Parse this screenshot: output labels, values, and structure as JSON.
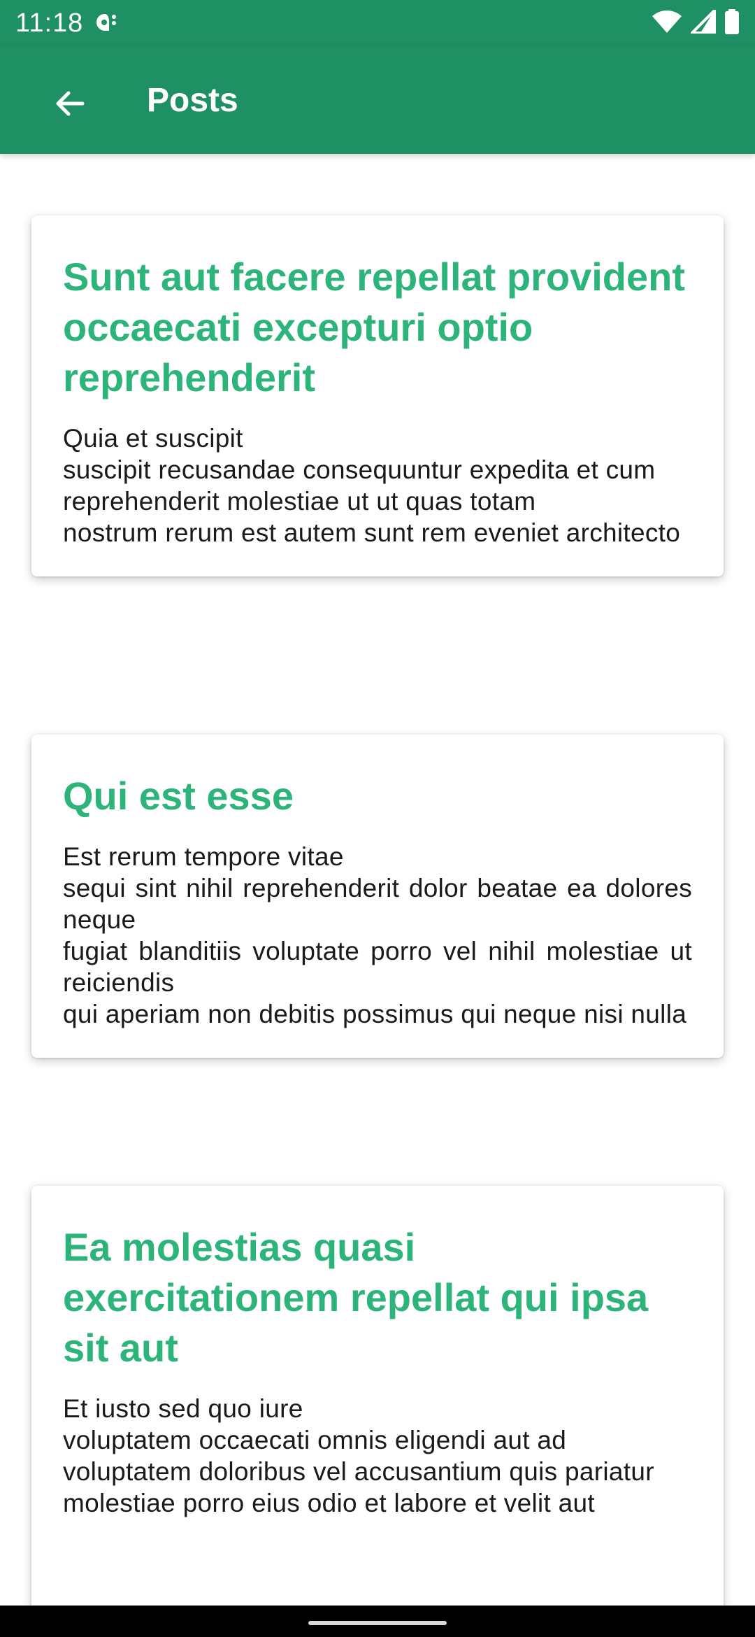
{
  "status_bar": {
    "time": "11:18",
    "icons": [
      "notification-icon",
      "wifi-icon",
      "signal-icon",
      "battery-icon"
    ]
  },
  "app_bar": {
    "back_icon": "arrow-back-icon",
    "title": "Posts",
    "color": "#1f9063"
  },
  "posts": [
    {
      "title": "Sunt aut facere repellat provident occaecati excepturi optio reprehenderit",
      "body_lines": [
        "Quia et suscipit",
        "suscipit recusandae consequuntur expedita et cum",
        "reprehenderit molestiae ut ut quas totam",
        "nostrum rerum est autem sunt rem eveniet architecto"
      ]
    },
    {
      "title": "Qui est esse",
      "body_lines": [
        "Est rerum tempore vitae",
        "sequi sint nihil reprehenderit dolor beatae ea dolores neque",
        "fugiat blanditiis voluptate porro vel nihil molestiae ut reiciendis",
        "qui aperiam non debitis possimus qui neque nisi nulla"
      ]
    },
    {
      "title": "Ea molestias quasi exercitationem repellat qui ipsa sit aut",
      "body_lines": [
        "Et iusto sed quo iure",
        "voluptatem occaecati omnis eligendi aut ad",
        "voluptatem doloribus vel accusantium quis pariatur",
        "molestiae porro eius odio et labore et velit aut"
      ]
    }
  ],
  "colors": {
    "title_accent": "#2db47b",
    "primary": "#1f9063"
  }
}
